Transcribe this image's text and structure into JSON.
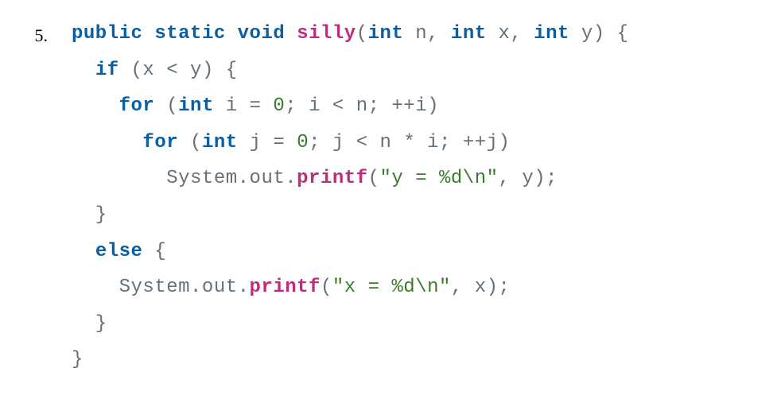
{
  "question_number": "5.",
  "code": {
    "kw_public": "public",
    "kw_static": "static",
    "kw_void": "void",
    "func_silly": "silly",
    "params": "(",
    "kw_int1": "int",
    "p_n": " n, ",
    "kw_int2": "int",
    "p_x": " x, ",
    "kw_int3": "int",
    "p_y": " y) {",
    "kw_if": "if",
    "if_cond": " (x < y) {",
    "kw_for1": "for",
    "for1_open": " (",
    "kw_int4": "int",
    "for1_var": " i = ",
    "num_zero1": "0",
    "for1_rest": "; i < n; ++i)",
    "kw_for2": "for",
    "for2_open": " (",
    "kw_int5": "int",
    "for2_var": " j = ",
    "num_zero2": "0",
    "for2_rest": "; j < n * i; ++j)",
    "sys1": "System.out.",
    "func_printf1": "printf",
    "printf1_open": "(",
    "str1": "\"y = %d\\n\"",
    "printf1_close": ", y);",
    "brace_close1": "  }",
    "kw_else": "else",
    "else_open": " {",
    "sys2": "System.out.",
    "func_printf2": "printf",
    "printf2_open": "(",
    "str2": "\"x = %d\\n\"",
    "printf2_close": ", x);",
    "brace_close2": "  }",
    "brace_close3": "}"
  }
}
